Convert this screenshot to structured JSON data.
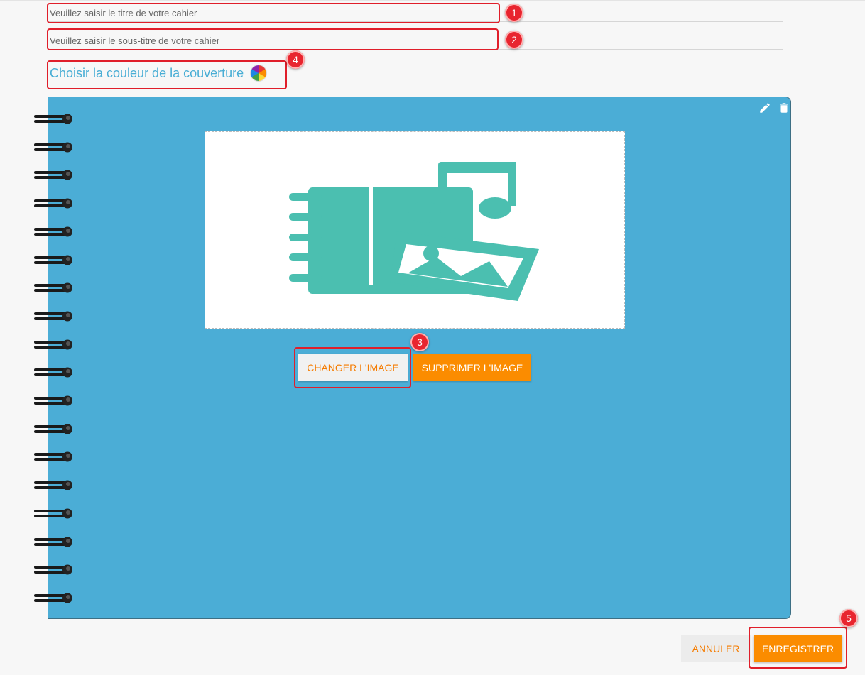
{
  "form": {
    "title_placeholder": "Veuillez saisir le titre de votre cahier",
    "title_value": "",
    "subtitle_placeholder": "Veuillez saisir le sous-titre de votre cahier",
    "subtitle_value": ""
  },
  "cover_color": {
    "label": "Choisir la couleur de la couverture",
    "icon": "color-wheel-icon",
    "color": "#4badd6"
  },
  "cover_tools": {
    "edit_icon": "pencil-icon",
    "delete_icon": "trash-icon"
  },
  "image_preview": {
    "icon": "notebook-music-image-icon",
    "icon_color": "#4bbfb0"
  },
  "image_buttons": {
    "change_label": "CHANGER L'IMAGE",
    "delete_label": "SUPPRIMER L'IMAGE"
  },
  "footer": {
    "cancel_label": "ANNULER",
    "save_label": "ENREGISTRER"
  },
  "annotations": [
    "1",
    "2",
    "3",
    "4",
    "5"
  ],
  "colors": {
    "accent": "#fb8c00",
    "highlight": "#e01e2a",
    "cover": "#4badd6",
    "link": "#4aaed5"
  }
}
